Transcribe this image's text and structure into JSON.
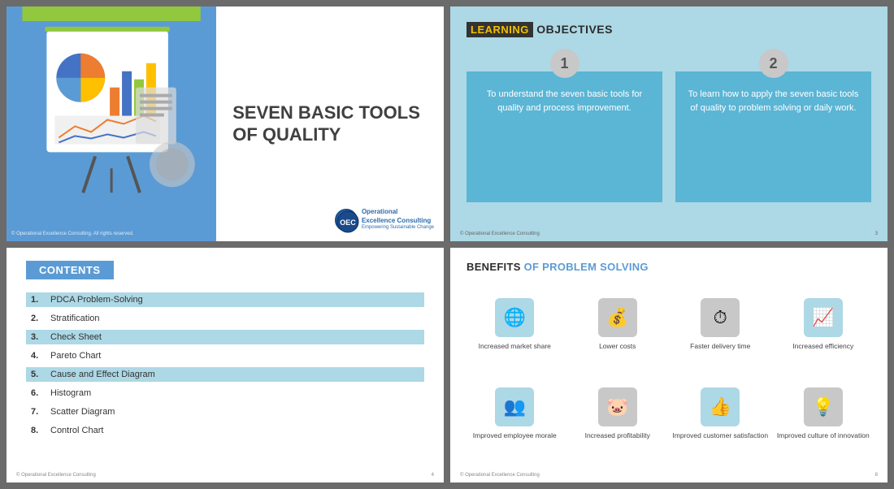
{
  "slide1": {
    "title_line1": "SEVEN BASIC TOOLS",
    "title_line2": "OF QUALITY",
    "copyright": "© Operational Excellence Consulting. All rights reserved.",
    "logo_text_line1": "Operational",
    "logo_text_line2": "Excellence Consulting",
    "logo_text_line3": "Empowering Sustainable Change"
  },
  "slide2": {
    "title_plain": "OBJECTIVES",
    "title_highlight": "LEARNING",
    "item1_number": "1",
    "item1_text": "To understand the seven basic tools for quality and process improvement.",
    "item2_number": "2",
    "item2_text": "To learn how to apply the seven basic tools of quality to problem solving or daily work.",
    "footer_left": "© Operational Excellence Consulting",
    "footer_right": "3"
  },
  "slide3": {
    "title": "CONTENTS",
    "items": [
      {
        "num": "1.",
        "label": "PDCA Problem-Solving",
        "highlighted": true
      },
      {
        "num": "2.",
        "label": "Stratification",
        "highlighted": false
      },
      {
        "num": "3.",
        "label": "Check Sheet",
        "highlighted": true
      },
      {
        "num": "4.",
        "label": "Pareto Chart",
        "highlighted": false
      },
      {
        "num": "5.",
        "label": "Cause and Effect Diagram",
        "highlighted": true
      },
      {
        "num": "6.",
        "label": "Histogram",
        "highlighted": false
      },
      {
        "num": "7.",
        "label": "Scatter Diagram",
        "highlighted": false
      },
      {
        "num": "8.",
        "label": "Control Chart",
        "highlighted": false
      }
    ],
    "footer_left": "© Operational Excellence Consulting",
    "footer_right": "4"
  },
  "slide4": {
    "title_part1": "BENEFITS",
    "title_part2": "OF PROBLEM SOLVING",
    "benefits": [
      {
        "label": "Increased market share",
        "icon": "🌐",
        "color": "blue"
      },
      {
        "label": "Lower costs",
        "icon": "💰",
        "color": "gray"
      },
      {
        "label": "Faster delivery time",
        "icon": "⏱",
        "color": "gray"
      },
      {
        "label": "Increased efficiency",
        "icon": "📈",
        "color": "blue"
      },
      {
        "label": "Improved employee morale",
        "icon": "👥",
        "color": "blue"
      },
      {
        "label": "Increased profitability",
        "icon": "🐷",
        "color": "gray"
      },
      {
        "label": "Improved customer satisfaction",
        "icon": "👍",
        "color": "blue"
      },
      {
        "label": "Improved culture of innovation",
        "icon": "💡",
        "color": "gray"
      }
    ],
    "footer_left": "© Operational Excellence Consulting",
    "footer_right": "8"
  }
}
